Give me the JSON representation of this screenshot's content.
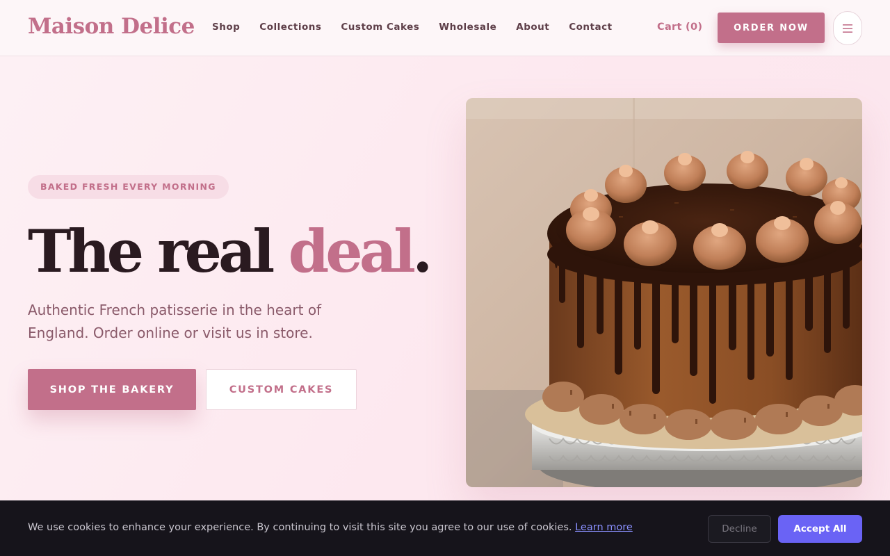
{
  "header": {
    "logo": "Maison Delice",
    "nav": [
      "Shop",
      "Collections",
      "Custom Cakes",
      "Wholesale",
      "About",
      "Contact"
    ],
    "cart_label": "Cart (0)",
    "order_button": "ORDER NOW",
    "menu_icon": "hamburger-menu-icon"
  },
  "hero": {
    "badge": "BAKED FRESH EVERY MORNING",
    "headline_part1": "The real ",
    "headline_accent": "deal",
    "headline_end": ".",
    "subtext": "Authentic French patisserie in the heart of England. Order online or visit us in store.",
    "primary_button": "SHOP THE BAKERY",
    "secondary_button": "CUSTOM CAKES"
  },
  "cookie_banner": {
    "text": "We use cookies to enhance your experience. By continuing to visit this site you agree to our use of cookies. ",
    "learn_more": "Learn more",
    "decline": "Decline",
    "accept": "Accept All"
  },
  "colors": {
    "brand": "#c26f8a",
    "dark_text": "#2a1a20",
    "banner_bg": "#16141b",
    "accept_button": "#6a63f5"
  }
}
